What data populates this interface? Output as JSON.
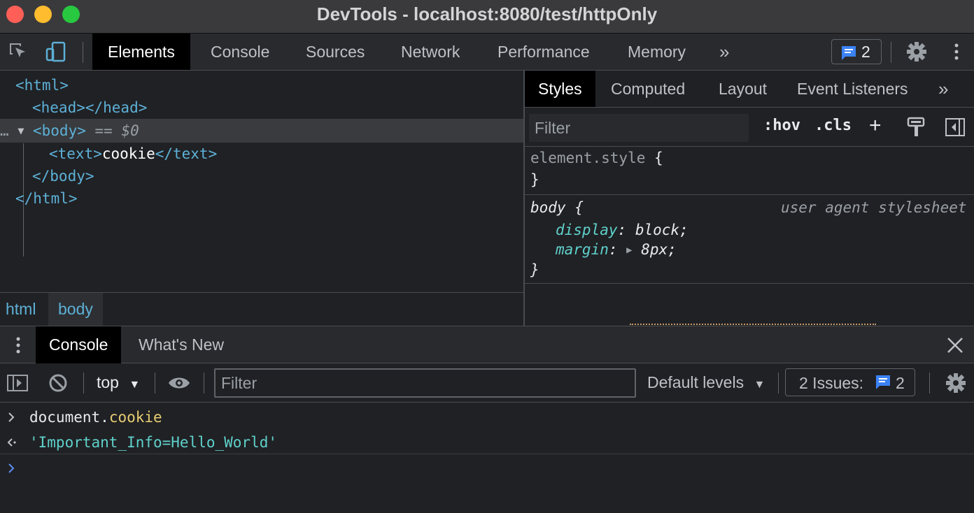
{
  "window": {
    "title": "DevTools - localhost:8080/test/httpOnly"
  },
  "toolbar": {
    "tabs": [
      "Elements",
      "Console",
      "Sources",
      "Network",
      "Performance",
      "Memory"
    ],
    "more": "»",
    "issues_count": "2"
  },
  "elements": {
    "lines": {
      "html_open": "<html>",
      "head": "<head></head>",
      "body_open": "<body>",
      "body_eq": "==",
      "body_ref": "$0",
      "text_open": "<text>",
      "text_content": "cookie",
      "text_close": "</text>",
      "body_close": "</body>",
      "html_close": "</html>"
    },
    "ellipsis": "…",
    "breadcrumbs": [
      "html",
      "body"
    ]
  },
  "styles": {
    "tabs": [
      "Styles",
      "Computed",
      "Layout",
      "Event Listeners"
    ],
    "more": "»",
    "filter_placeholder": "Filter",
    "hov": ":hov",
    "cls": ".cls",
    "plus": "+",
    "rules": {
      "element_style": {
        "selector": "element.style",
        "open": "{",
        "close": "}"
      },
      "body": {
        "selector": "body",
        "open": "{",
        "source": "user agent stylesheet",
        "decl1_prop": "display",
        "decl1_val": "block;",
        "decl2_prop": "margin",
        "decl2_val": "8px;",
        "close": "}"
      }
    }
  },
  "drawer": {
    "tabs": [
      "Console",
      "What's New"
    ]
  },
  "console": {
    "context": "top",
    "filter_placeholder": "Filter",
    "levels": "Default levels",
    "issues_label": "2 Issues:",
    "issues_count": "2",
    "input_object": "document",
    "input_dot": ".",
    "input_prop": "cookie",
    "output": "'Important_Info=Hello_World'"
  },
  "colors": {
    "tag": "#5db0d7",
    "property": "#5fd1cc",
    "accent_blue": "#3b82f6"
  }
}
